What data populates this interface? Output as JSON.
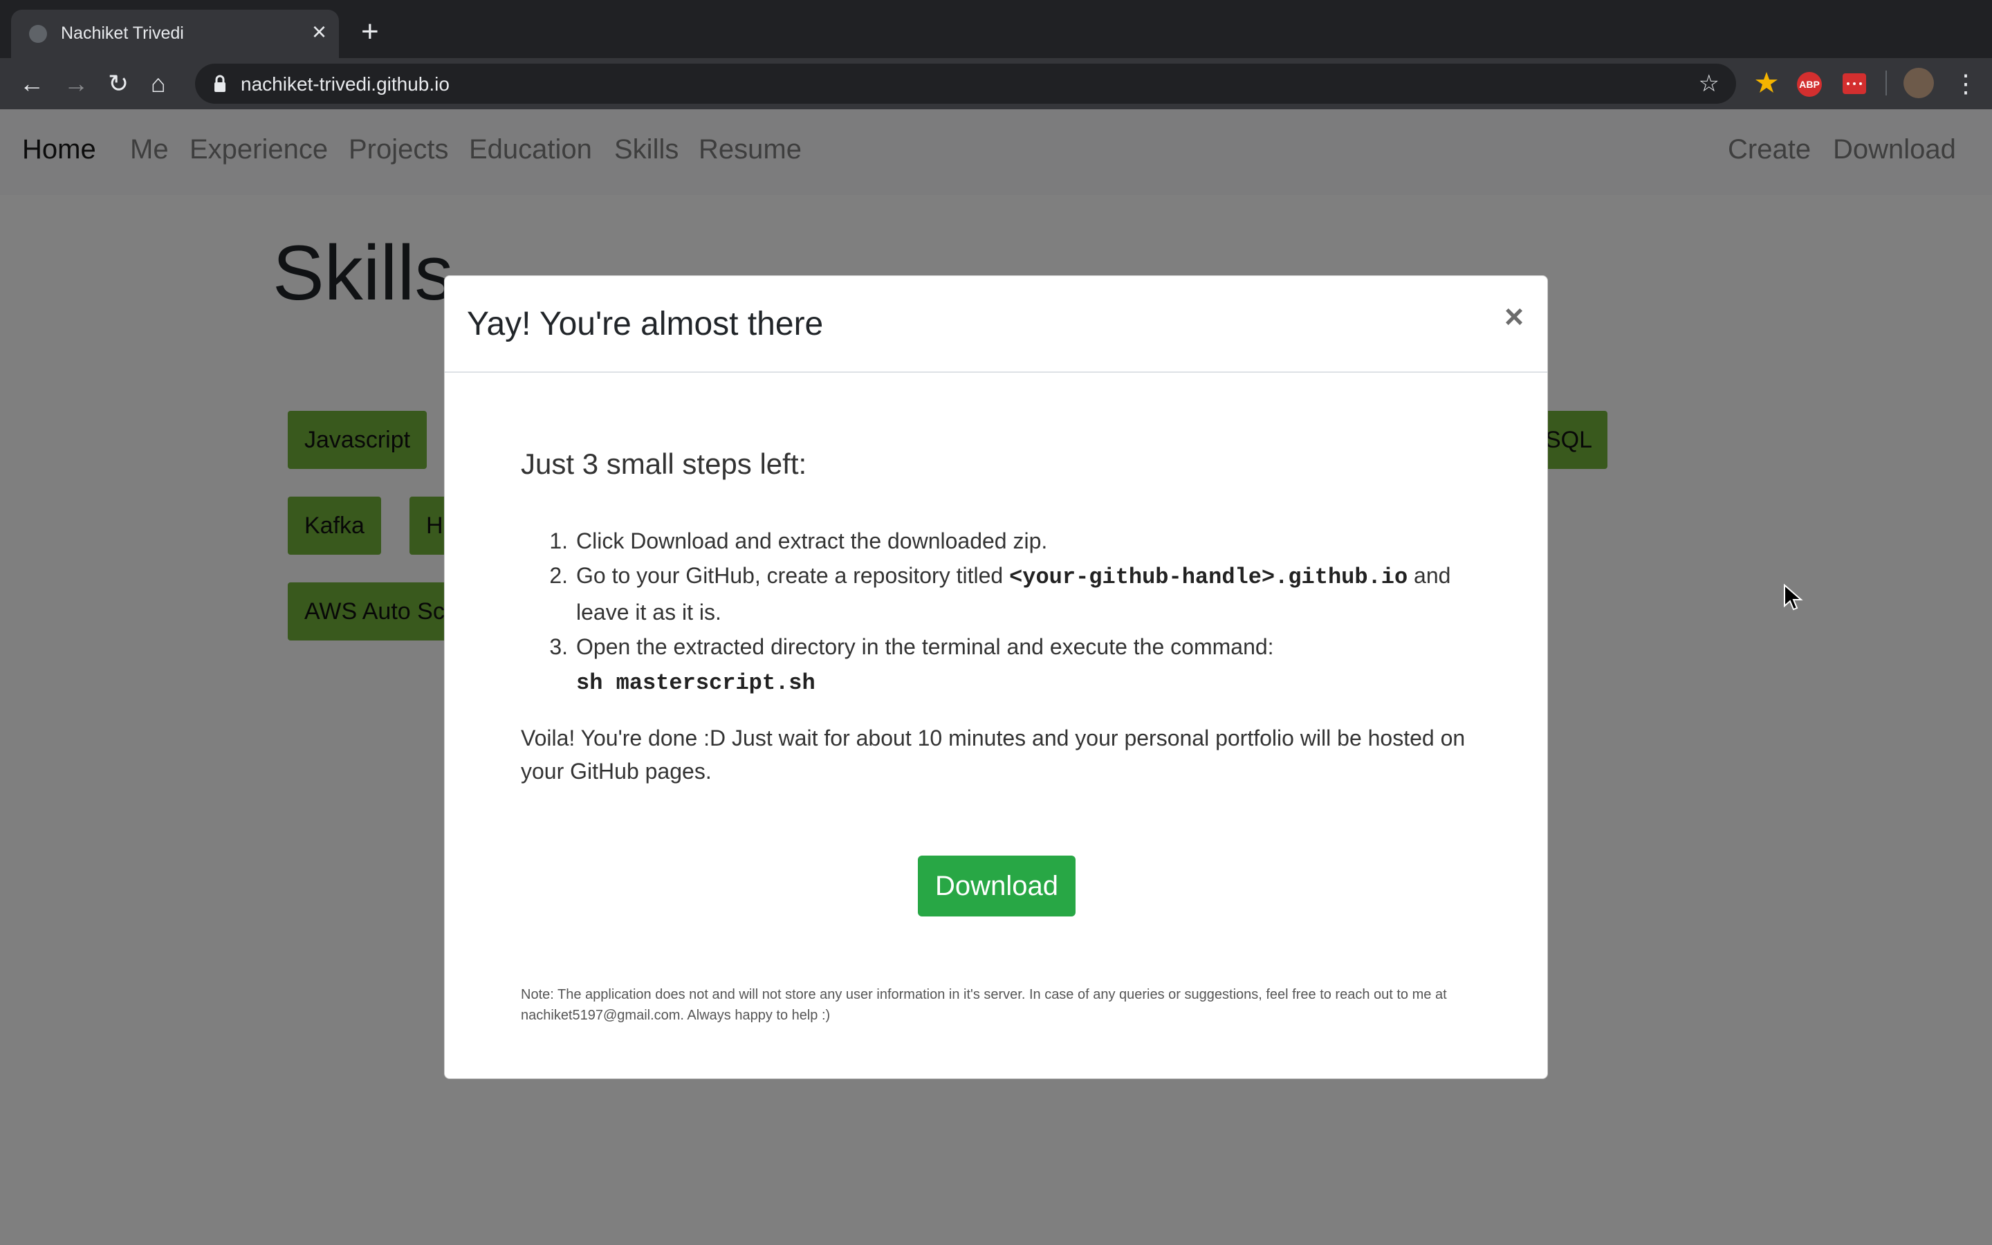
{
  "browser": {
    "tab_title": "Nachiket Trivedi",
    "tab_close": "×",
    "new_tab": "+",
    "url": "nachiket-trivedi.github.io",
    "abp_label": "ABP",
    "back_icon": "←",
    "forward_icon": "→",
    "reload_icon": "↻",
    "home_icon": "⌂",
    "star_icon": "☆",
    "menu_icon": "⋮"
  },
  "site_nav": {
    "brand": "Home",
    "links": [
      "Me",
      "Experience",
      "Projects",
      "Education",
      "Skills",
      "Resume"
    ],
    "right_links": [
      "Create",
      "Download"
    ]
  },
  "page": {
    "heading": "Skills",
    "skills_visible": [
      "Javascript",
      "SQL",
      "Kafka",
      "H",
      "AWS Auto Sc"
    ]
  },
  "modal": {
    "title": "Yay! You're almost there",
    "close": "×",
    "steps_heading": "Just 3 small steps left:",
    "steps": [
      {
        "num": "1.",
        "text": "Click Download and extract the downloaded zip."
      },
      {
        "num": "2.",
        "text_before": "Go to your GitHub, create a repository titled ",
        "code": "<your-github-handle>.github.io",
        "text_after": " and leave it as it is."
      },
      {
        "num": "3.",
        "text": "Open the extracted directory in the terminal and execute the command:",
        "code": "sh masterscript.sh"
      }
    ],
    "voila": "Voila! You're done :D Just wait for about 10 minutes and your personal portfolio will be hosted on your GitHub pages.",
    "download_label": "Download",
    "note": "Note: The application does not and will not store any user information in it's server. In case of any queries or suggestions, feel free to reach out to me at nachiket5197@gmail.com. Always happy to help :)"
  },
  "colors": {
    "skill_badge": "#72b33a",
    "download_button": "#28a745",
    "backdrop": "rgba(0,0,0,0.5)"
  }
}
